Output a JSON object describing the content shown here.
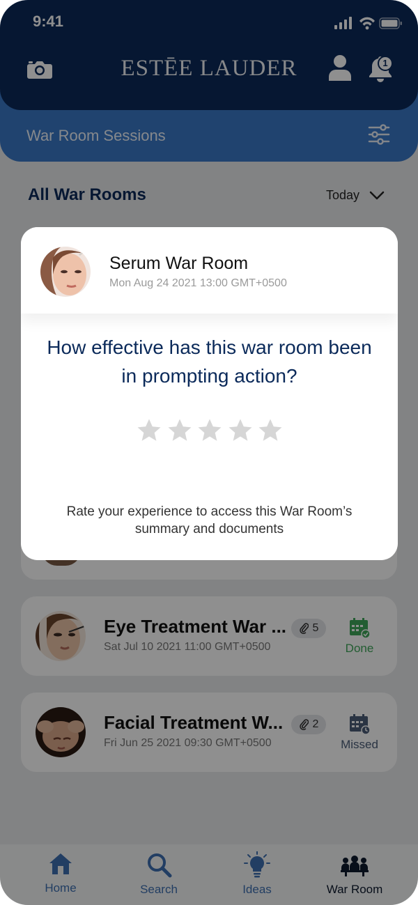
{
  "status_bar": {
    "time": "9:41"
  },
  "header": {
    "brand": "ESTĒE LAUDER",
    "notification_count": "1"
  },
  "subheader": {
    "title": "War Room Sessions"
  },
  "list": {
    "title": "All War Rooms",
    "filter": "Today",
    "items": [
      {
        "title": "Eye Treatment War ...",
        "date": "Sat Jul 10 2021 11:00 GMT+0500",
        "attachments": "5",
        "status": "Done"
      },
      {
        "title": "Facial Treatment W...",
        "date": "Fri Jun 25 2021 09:30 GMT+0500",
        "attachments": "2",
        "status": "Missed"
      }
    ]
  },
  "modal": {
    "title": "Serum War Room",
    "date": "Mon Aug 24 2021 13:00 GMT+0500",
    "question": "How effective has this war room been in prompting action?",
    "rating": 0,
    "rating_max": 5,
    "hint": "Rate your experience to access this War Room’s summary and documents"
  },
  "tabs": [
    {
      "label": "Home",
      "icon": "home-icon"
    },
    {
      "label": "Search",
      "icon": "search-icon"
    },
    {
      "label": "Ideas",
      "icon": "lightbulb-icon"
    },
    {
      "label": "War Room",
      "icon": "team-icon",
      "active": true
    }
  ],
  "colors": {
    "navy": "#0b2a5a",
    "blue": "#3a78c6",
    "done": "#3fa65a",
    "missed": "#4b5d78",
    "star_empty": "#d6d6d6"
  }
}
